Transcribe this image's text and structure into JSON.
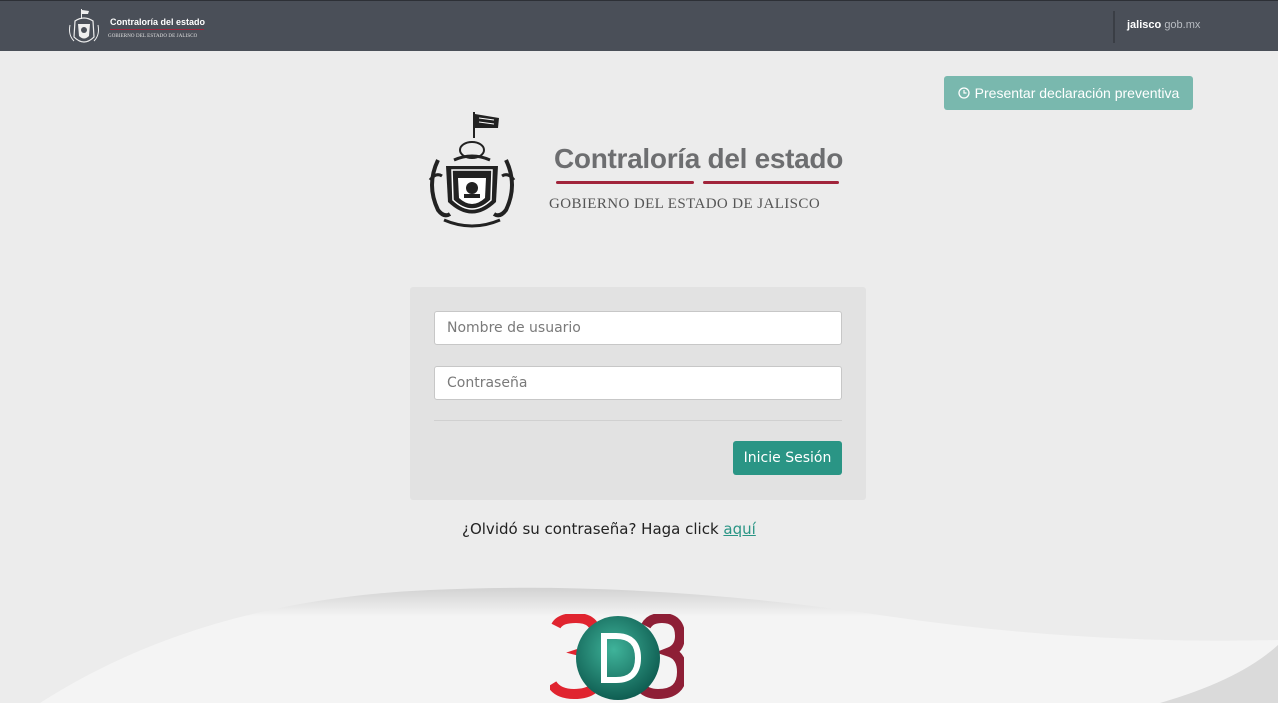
{
  "header": {
    "logo_title": "Contraloría del estado",
    "logo_subtitle": "GOBIERNO DEL ESTADO DE JALISCO",
    "right_bold": "jalisco",
    "right_light": "gob.mx"
  },
  "preventive_button": {
    "label": "Presentar declaración preventiva",
    "icon": "clock-icon"
  },
  "main_logo": {
    "title": "Contraloría del estado",
    "subtitle": "GOBIERNO DEL ESTADO DE JALISCO"
  },
  "login": {
    "username_placeholder": "Nombre de usuario",
    "username_value": "",
    "password_placeholder": "Contraseña",
    "password_value": "",
    "submit_label": "Inicie Sesión"
  },
  "forgot": {
    "text": "¿Olvidó su contraseña? Haga click ",
    "link": "aquí"
  },
  "footer_logo": {
    "text": "3D3"
  },
  "colors": {
    "topbar": "#4a4f58",
    "accent": "#2a9585",
    "preventive": "#79b8ae",
    "brand_red": "#a1243b"
  }
}
